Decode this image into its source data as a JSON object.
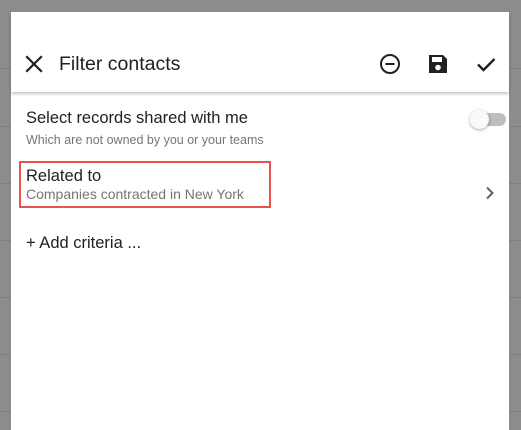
{
  "dialog": {
    "title": "Filter contacts",
    "actions": {
      "close": "close-icon",
      "remove": "remove-circle-icon",
      "save": "save-icon",
      "apply": "check-icon"
    }
  },
  "shared": {
    "title": "Select records shared with me",
    "subtitle": "Which are not owned by you or your teams",
    "toggle_on": false
  },
  "related": {
    "title": "Related to",
    "subtitle": "Companies contracted in New York",
    "highlight_color": "#e8534f"
  },
  "add_criteria": "+ Add criteria ..."
}
